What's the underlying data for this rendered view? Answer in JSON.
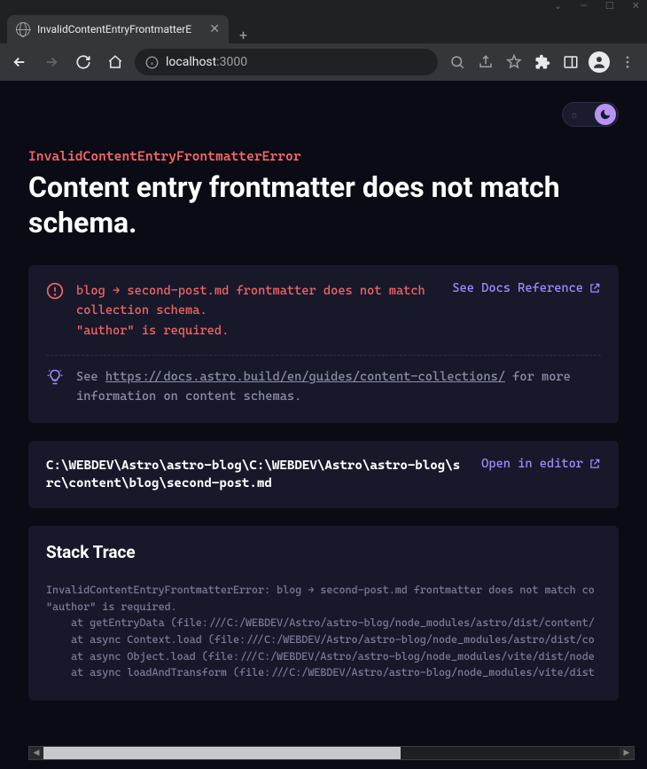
{
  "window": {
    "tab_title": "InvalidContentEntryFrontmatterE",
    "url_host": "localhost",
    "url_port": ":3000"
  },
  "error": {
    "type": "InvalidContentEntryFrontmatterError",
    "title": "Content entry frontmatter does not match schema.",
    "message_line1": "blog → second-post.md frontmatter does not match collection schema.",
    "message_line2": "\"author\" is required.",
    "docs_link_label": "See Docs Reference",
    "hint_prefix": "See ",
    "hint_url": "https://docs.astro.build/en/guides/content-collections/",
    "hint_suffix": " for more information on content schemas."
  },
  "file": {
    "path": "C:\\WEBDEV\\Astro\\astro-blog\\C:\\WEBDEV\\Astro\\astro-blog\\src\\content\\blog\\second-post.md",
    "open_label": "Open in editor"
  },
  "stack": {
    "title": "Stack Trace",
    "lines": [
      "InvalidContentEntryFrontmatterError: blog → second-post.md frontmatter does not match co",
      "\"author\" is required.",
      "    at getEntryData (file:///C:/WEBDEV/Astro/astro-blog/node_modules/astro/dist/content/",
      "    at async Context.load (file:///C:/WEBDEV/Astro/astro-blog/node_modules/astro/dist/co",
      "    at async Object.load (file:///C:/WEBDEV/Astro/astro-blog/node_modules/vite/dist/node",
      "    at async loadAndTransform (file:///C:/WEBDEV/Astro/astro-blog/node_modules/vite/dist"
    ]
  }
}
